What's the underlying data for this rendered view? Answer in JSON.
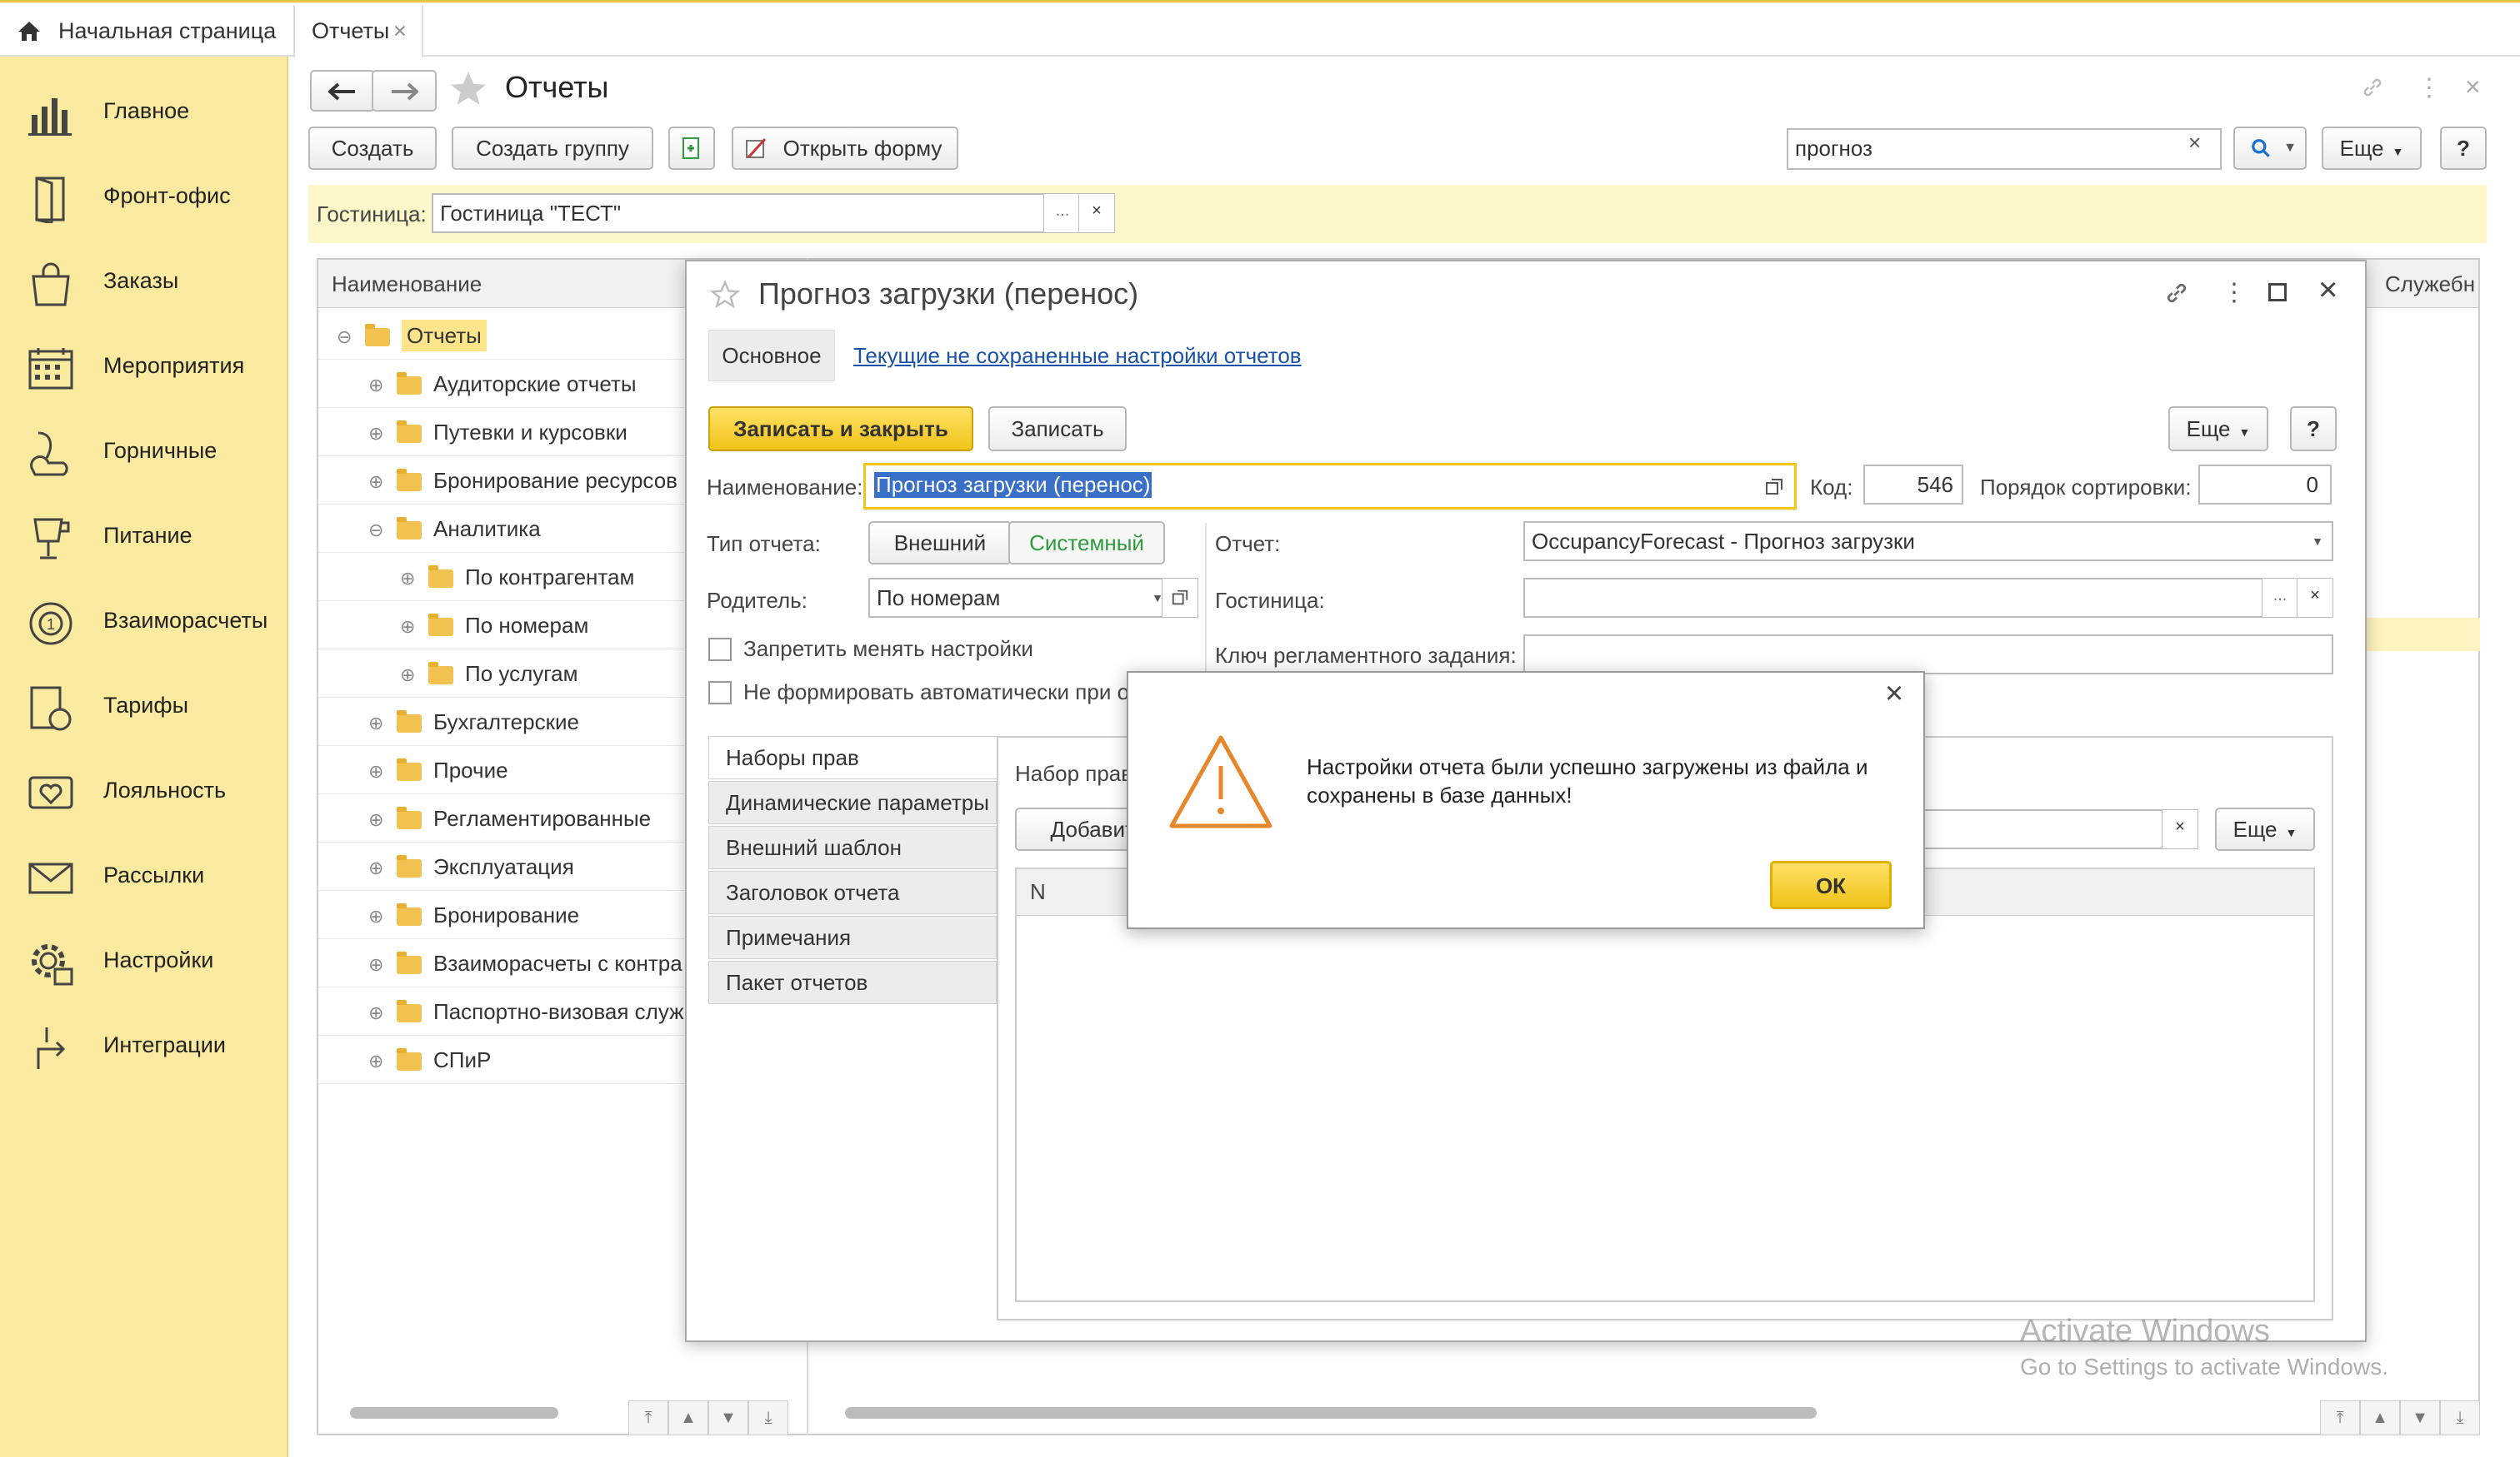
{
  "tabs": {
    "home": "Начальная страница",
    "reports": "Отчеты",
    "close": "×"
  },
  "sidebar": {
    "items": [
      {
        "label": "Главное",
        "icon": "chart-bar-icon"
      },
      {
        "label": "Фронт-офис",
        "icon": "door-icon"
      },
      {
        "label": "Заказы",
        "icon": "shopping-bag-icon"
      },
      {
        "label": "Мероприятия",
        "icon": "calendar-icon"
      },
      {
        "label": "Горничные",
        "icon": "vacuum-icon"
      },
      {
        "label": "Питание",
        "icon": "cup-icon"
      },
      {
        "label": "Взаиморасчеты",
        "icon": "money-cycle-icon"
      },
      {
        "label": "Тарифы",
        "icon": "tariff-icon"
      },
      {
        "label": "Лояльность",
        "icon": "heart-card-icon"
      },
      {
        "label": "Рассылки",
        "icon": "mail-icon"
      },
      {
        "label": "Настройки",
        "icon": "gear-icon"
      },
      {
        "label": "Интеграции",
        "icon": "integration-icon"
      }
    ]
  },
  "page": {
    "title": "Отчеты",
    "create": "Создать",
    "create_group": "Создать группу",
    "open_form": "Открыть форму",
    "search_value": "прогноз",
    "more": "Еще",
    "help": "?",
    "hotel_label": "Гостиница:",
    "hotel_value": "Гостиница \"ТЕСТ\"",
    "dots": "...",
    "clear": "×"
  },
  "tree": {
    "header": "Наименование",
    "service_header": "Служебн",
    "rows": [
      {
        "label": "Отчеты",
        "level": 0,
        "sign": "⊖"
      },
      {
        "label": "Аудиторские отчеты",
        "level": 1,
        "sign": "⊕"
      },
      {
        "label": "Путевки и курсовки",
        "level": 1,
        "sign": "⊕"
      },
      {
        "label": "Бронирование ресурсов",
        "level": 1,
        "sign": "⊕"
      },
      {
        "label": "Аналитика",
        "level": 1,
        "sign": "⊖"
      },
      {
        "label": "По контрагентам",
        "level": 2,
        "sign": "⊕"
      },
      {
        "label": "По номерам",
        "level": 2,
        "sign": "⊕"
      },
      {
        "label": "По услугам",
        "level": 2,
        "sign": "⊕"
      },
      {
        "label": "Бухгалтерские",
        "level": 1,
        "sign": "⊕"
      },
      {
        "label": "Прочие",
        "level": 1,
        "sign": "⊕"
      },
      {
        "label": "Регламентированные",
        "level": 1,
        "sign": "⊕"
      },
      {
        "label": "Эксплуатация",
        "level": 1,
        "sign": "⊕"
      },
      {
        "label": "Бронирование",
        "level": 1,
        "sign": "⊕"
      },
      {
        "label": "Взаиморасчеты с контра",
        "level": 1,
        "sign": "⊕"
      },
      {
        "label": "Паспортно-визовая служ",
        "level": 1,
        "sign": "⊕"
      },
      {
        "label": "СПиР",
        "level": 1,
        "sign": "⊕"
      }
    ]
  },
  "modal": {
    "title": "Прогноз загрузки (перенос)",
    "tab_main": "Основное",
    "tab_link": "Текущие не сохраненные настройки отчетов",
    "save_close": "Записать и закрыть",
    "save": "Записать",
    "more": "Еще",
    "help": "?",
    "name_label": "Наименование:",
    "name_value": "Прогноз загрузки (перенос)",
    "code_label": "Код:",
    "code_value": "546",
    "sort_label": "Порядок сортировки:",
    "sort_value": "0",
    "type_label": "Тип отчета:",
    "type_external": "Внешний",
    "type_system": "Системный",
    "report_label": "Отчет:",
    "report_value": "OccupancyForecast - Прогноз загрузки",
    "parent_label": "Родитель:",
    "parent_value": "По номерам",
    "hotel_label": "Гостиница:",
    "key_label": "Ключ регламентного задания:",
    "forbid_label": "Запретить менять настройки",
    "noauto_label": "Не формировать автоматически при от",
    "vtabs": [
      "Наборы прав",
      "Динамические параметры",
      "Внешний шаблон",
      "Заголовок отчета",
      "Примечания",
      "Пакет отчетов"
    ],
    "rights_label": "Набор прав",
    "add": "Добавить",
    "col_n": "N",
    "more2": "Еще"
  },
  "alert": {
    "message_line1": "Настройки отчета были успешно загружены из файла и",
    "message_line2": "сохранены в базе данных!",
    "ok": "ОК",
    "close": "×"
  },
  "watermark": {
    "title": "Activate Windows",
    "subtitle": "Go to Settings to activate Windows."
  },
  "colors": {
    "accent": "#f0c419",
    "sidebar": "#faeaa0",
    "warning": "#e8862a",
    "system_green": "#2e9b3e",
    "link": "#1a52a8"
  }
}
